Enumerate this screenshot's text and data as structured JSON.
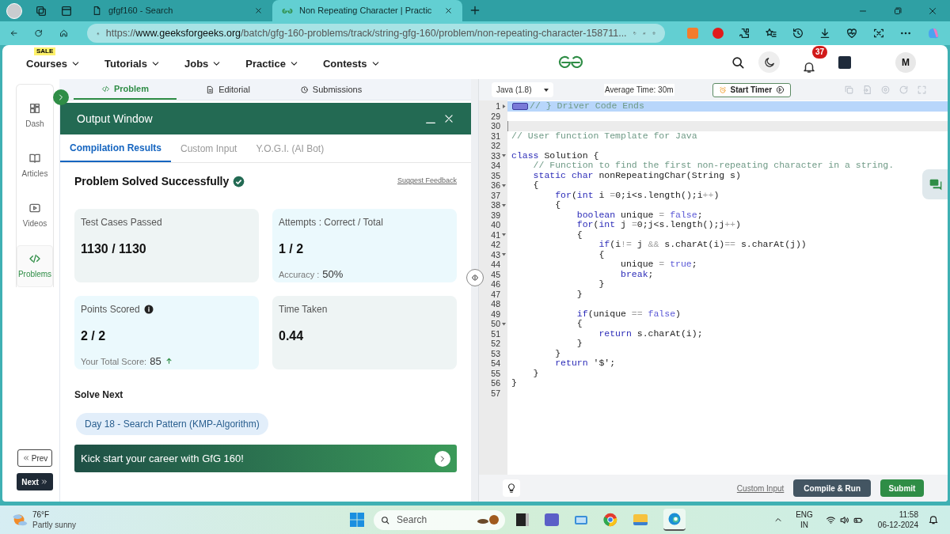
{
  "browser": {
    "tabs": [
      {
        "title": "gfgf160 - Search",
        "selected": false
      },
      {
        "title": "Non Repeating Character | Practic",
        "selected": true
      }
    ],
    "url": "https://**www.geeksforgeeks.org**/batch/gfg-160-problems/track/string-gfg-160/problem/non-repeating-character-158711..."
  },
  "site_nav": {
    "sale_badge": "SALE",
    "menu": [
      "Courses",
      "Tutorials",
      "Jobs",
      "Practice",
      "Contests"
    ],
    "notification_count": "37",
    "avatar": "M"
  },
  "sidebar": {
    "items": [
      {
        "label": "Dash",
        "selected": false
      },
      {
        "label": "Articles",
        "selected": false
      },
      {
        "label": "Videos",
        "selected": false
      },
      {
        "label": "Problems",
        "selected": true
      }
    ],
    "prev": "Prev",
    "next": "Next"
  },
  "problem_tabs": [
    {
      "label": "Problem",
      "selected": true
    },
    {
      "label": "Editorial",
      "selected": false
    },
    {
      "label": "Submissions",
      "selected": false
    }
  ],
  "output_window": {
    "title": "Output Window",
    "tabs": [
      {
        "label": "Compilation Results",
        "selected": true
      },
      {
        "label": "Custom Input",
        "selected": false
      },
      {
        "label": "Y.O.G.I. (AI Bot)",
        "selected": false
      }
    ],
    "status": "Problem Solved Successfully",
    "feedback_link": "Suggest Feedback",
    "cards": [
      {
        "label": "Test Cases Passed",
        "value": "1130 / 1130",
        "color": "#eef4f4"
      },
      {
        "label": "Attempts : Correct / Total",
        "value": "1 / 2",
        "note_label": "Accuracy :",
        "note_value": "50%",
        "color": "#ebf9fd"
      },
      {
        "label": "Points Scored",
        "value": "2 / 2",
        "note_label": "Your Total Score:",
        "note_value": "85",
        "info": true,
        "trend_up": true,
        "color": "#ebf9fd"
      },
      {
        "label": "Time Taken",
        "value": "0.44",
        "color": "#eef4f4"
      }
    ],
    "solve_next": {
      "heading": "Solve Next",
      "chip": "Day 18 - Search Pattern (KMP-Algorithm)"
    },
    "banner": "Kick start your career with GfG 160!"
  },
  "editor": {
    "language": "Java (1.8)",
    "average_time": "Average Time: 30m",
    "timer_button": "Start Timer",
    "lines": [
      {
        "number": "1",
        "foldable": true,
        "folded": true,
        "current": false,
        "tokens": [
          {
            "kind": "cm",
            "text": "// } Driver Code Ends"
          }
        ]
      },
      {
        "number": "29",
        "foldable": false,
        "folded": false,
        "current": false
      },
      {
        "number": "30",
        "foldable": false,
        "folded": false,
        "current": true
      },
      {
        "number": "31",
        "foldable": false,
        "folded": false,
        "current": false,
        "tokens": [
          {
            "kind": "cm",
            "text": "// User function Template for Java"
          }
        ]
      },
      {
        "number": "32",
        "foldable": false,
        "folded": false,
        "current": false
      },
      {
        "number": "33",
        "foldable": true,
        "folded": false,
        "current": false,
        "tokens": [
          {
            "kind": "kw",
            "text": "class"
          },
          {
            "kind": "tx",
            "text": " Solution {"
          }
        ]
      },
      {
        "number": "34",
        "foldable": false,
        "folded": false,
        "current": false,
        "tokens": [
          {
            "kind": "cm",
            "text": "    // Function to find the first non-repeating character in a string."
          }
        ]
      },
      {
        "number": "35",
        "foldable": false,
        "folded": false,
        "current": false,
        "tokens": [
          {
            "kind": "kw",
            "text": "    static char"
          },
          {
            "kind": "tx",
            "text": " nonRepeatingChar(String s)"
          }
        ]
      },
      {
        "number": "36",
        "foldable": true,
        "folded": false,
        "current": false,
        "tokens": [
          {
            "kind": "tx",
            "text": "    {"
          }
        ]
      },
      {
        "number": "37",
        "foldable": false,
        "folded": false,
        "current": false,
        "tokens": [
          {
            "kind": "kw",
            "text": "        for"
          },
          {
            "kind": "tx",
            "text": "("
          },
          {
            "kind": "kw",
            "text": "int"
          },
          {
            "kind": "tx",
            "text": " i "
          },
          {
            "kind": "op",
            "text": "="
          },
          {
            "kind": "tx",
            "text": "0;i<s.length();i"
          },
          {
            "kind": "op",
            "text": "++"
          },
          {
            "kind": "tx",
            "text": ")"
          }
        ]
      },
      {
        "number": "38",
        "foldable": true,
        "folded": false,
        "current": false,
        "tokens": [
          {
            "kind": "tx",
            "text": "        {"
          }
        ]
      },
      {
        "number": "39",
        "foldable": false,
        "folded": false,
        "current": false,
        "tokens": [
          {
            "kind": "kw",
            "text": "            boolean"
          },
          {
            "kind": "tx",
            "text": " unique "
          },
          {
            "kind": "op",
            "text": "="
          },
          {
            "kind": "lit",
            "text": " false"
          },
          {
            "kind": "tx",
            "text": ";"
          }
        ]
      },
      {
        "number": "40",
        "foldable": false,
        "folded": false,
        "current": false,
        "tokens": [
          {
            "kind": "kw",
            "text": "            for"
          },
          {
            "kind": "tx",
            "text": "("
          },
          {
            "kind": "kw",
            "text": "int"
          },
          {
            "kind": "tx",
            "text": " j "
          },
          {
            "kind": "op",
            "text": "="
          },
          {
            "kind": "tx",
            "text": "0;j<s.length();j"
          },
          {
            "kind": "op",
            "text": "++"
          },
          {
            "kind": "tx",
            "text": ")"
          }
        ]
      },
      {
        "number": "41",
        "foldable": true,
        "folded": false,
        "current": false,
        "tokens": [
          {
            "kind": "tx",
            "text": "            {"
          }
        ]
      },
      {
        "number": "42",
        "foldable": false,
        "folded": false,
        "current": false,
        "tokens": [
          {
            "kind": "kw",
            "text": "                if"
          },
          {
            "kind": "tx",
            "text": "(i"
          },
          {
            "kind": "op",
            "text": "!="
          },
          {
            "kind": "tx",
            "text": " j "
          },
          {
            "kind": "op",
            "text": "&&"
          },
          {
            "kind": "tx",
            "text": " s.charAt(i)"
          },
          {
            "kind": "op",
            "text": "=="
          },
          {
            "kind": "tx",
            "text": " s.charAt(j))"
          }
        ]
      },
      {
        "number": "43",
        "foldable": true,
        "folded": false,
        "current": false,
        "tokens": [
          {
            "kind": "tx",
            "text": "                {"
          }
        ]
      },
      {
        "number": "44",
        "foldable": false,
        "folded": false,
        "current": false,
        "tokens": [
          {
            "kind": "tx",
            "text": "                    unique "
          },
          {
            "kind": "op",
            "text": "="
          },
          {
            "kind": "lit",
            "text": " true"
          },
          {
            "kind": "tx",
            "text": ";"
          }
        ]
      },
      {
        "number": "45",
        "foldable": false,
        "folded": false,
        "current": false,
        "tokens": [
          {
            "kind": "kw",
            "text": "                    break"
          },
          {
            "kind": "tx",
            "text": ";"
          }
        ]
      },
      {
        "number": "46",
        "foldable": false,
        "folded": false,
        "current": false,
        "tokens": [
          {
            "kind": "tx",
            "text": "                }"
          }
        ]
      },
      {
        "number": "47",
        "foldable": false,
        "folded": false,
        "current": false,
        "tokens": [
          {
            "kind": "tx",
            "text": "            }"
          }
        ]
      },
      {
        "number": "48",
        "foldable": false,
        "folded": false,
        "current": false
      },
      {
        "number": "49",
        "foldable": false,
        "folded": false,
        "current": false,
        "tokens": [
          {
            "kind": "kw",
            "text": "            if"
          },
          {
            "kind": "tx",
            "text": "(unique "
          },
          {
            "kind": "op",
            "text": "=="
          },
          {
            "kind": "lit",
            "text": " false"
          },
          {
            "kind": "tx",
            "text": ")"
          }
        ]
      },
      {
        "number": "50",
        "foldable": true,
        "folded": false,
        "current": false,
        "tokens": [
          {
            "kind": "tx",
            "text": "            {"
          }
        ]
      },
      {
        "number": "51",
        "foldable": false,
        "folded": false,
        "current": false,
        "tokens": [
          {
            "kind": "kw",
            "text": "                return"
          },
          {
            "kind": "tx",
            "text": " s.charAt(i);"
          }
        ]
      },
      {
        "number": "52",
        "foldable": false,
        "folded": false,
        "current": false,
        "tokens": [
          {
            "kind": "tx",
            "text": "            }"
          }
        ]
      },
      {
        "number": "53",
        "foldable": false,
        "folded": false,
        "current": false,
        "tokens": [
          {
            "kind": "tx",
            "text": "        }"
          }
        ]
      },
      {
        "number": "54",
        "foldable": false,
        "folded": false,
        "current": false,
        "tokens": [
          {
            "kind": "kw",
            "text": "        return"
          },
          {
            "kind": "tx",
            "text": " '$';"
          }
        ]
      },
      {
        "number": "55",
        "foldable": false,
        "folded": false,
        "current": false,
        "tokens": [
          {
            "kind": "tx",
            "text": "    }"
          }
        ]
      },
      {
        "number": "56",
        "foldable": false,
        "folded": false,
        "current": false,
        "tokens": [
          {
            "kind": "tx",
            "text": "}"
          }
        ]
      },
      {
        "number": "57",
        "foldable": false,
        "folded": false,
        "current": false
      }
    ],
    "custom_input_link": "Custom Input",
    "compile_button": "Compile & Run",
    "submit_button": "Submit"
  },
  "taskbar": {
    "temperature": "76°F",
    "weather": "Partly sunny",
    "search": "Search",
    "language": "ENG",
    "region": "IN",
    "time": "11:58",
    "date": "06-12-2024"
  }
}
